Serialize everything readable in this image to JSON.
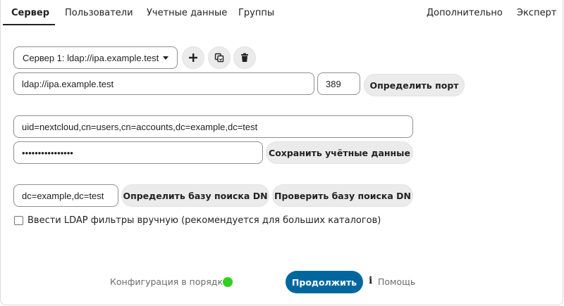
{
  "tabs": {
    "server": "Сервер",
    "users": "Пользователи",
    "credentials": "Учетные данные",
    "groups": "Группы",
    "advanced": "Дополнительно",
    "expert": "Эксперт"
  },
  "server_select": {
    "value": "Сервер 1: ldap://ipa.example.test",
    "options": [
      "Сервер 1: ldap://ipa.example.test"
    ]
  },
  "icons": {
    "add": "plus-icon",
    "copy": "copy-icon",
    "delete": "trash-icon"
  },
  "host": {
    "value": "ldap://ipa.example.test",
    "port": "389",
    "detect_port_label": "Определить порт"
  },
  "credentials": {
    "user_dn": "uid=nextcloud,cn=users,cn=accounts,dc=example,dc=test",
    "password": "••••••••••••••••",
    "save_label": "Сохранить учётные данные"
  },
  "base_dn": {
    "value": "dc=example,dc=test",
    "detect_label": "Определить базу поиска DN",
    "test_label": "Проверить базу поиска DN"
  },
  "manual_filters": {
    "checked": false,
    "label": "Ввести LDAP фильтры вручную (рекомендуется для больших каталогов)"
  },
  "footer": {
    "status": "Конфигурация в порядке",
    "status_color": "#2fd11c",
    "continue_label": "Продолжить",
    "help_label": "Помощь",
    "primary_color": "#00679e"
  }
}
